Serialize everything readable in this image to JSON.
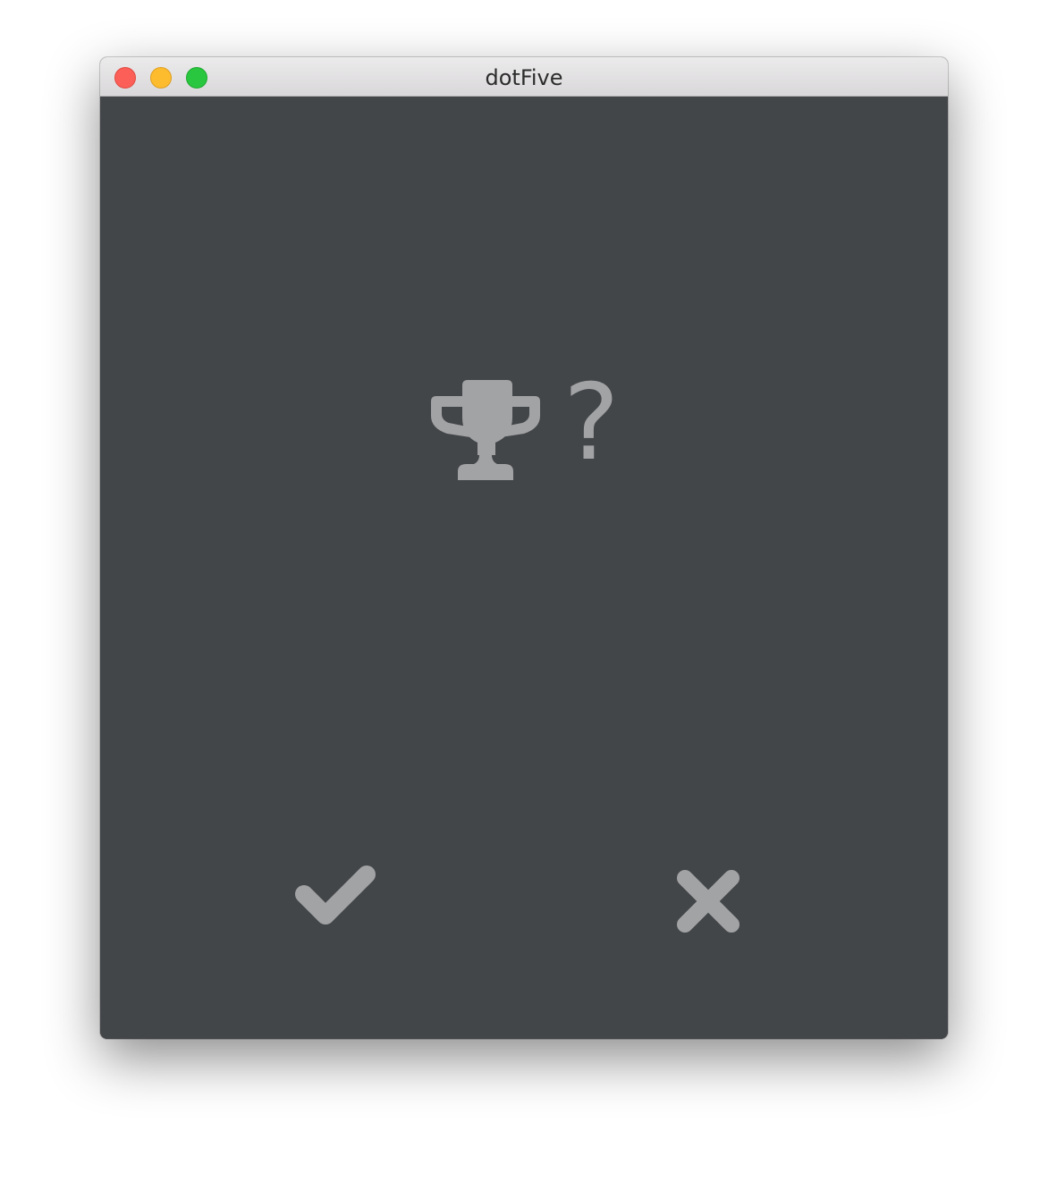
{
  "window": {
    "title": "dotFive"
  },
  "prompt": {
    "icon": "trophy-icon",
    "text": "?"
  },
  "actions": {
    "accept_icon": "checkmark-icon",
    "reject_icon": "close-x-icon"
  },
  "colors": {
    "background": "#434649",
    "icon": "#a2a3a5",
    "titlebar": "#e3e1e3",
    "close": "#fc5f57",
    "minimize": "#fdbc2e",
    "zoom": "#29c73f"
  }
}
